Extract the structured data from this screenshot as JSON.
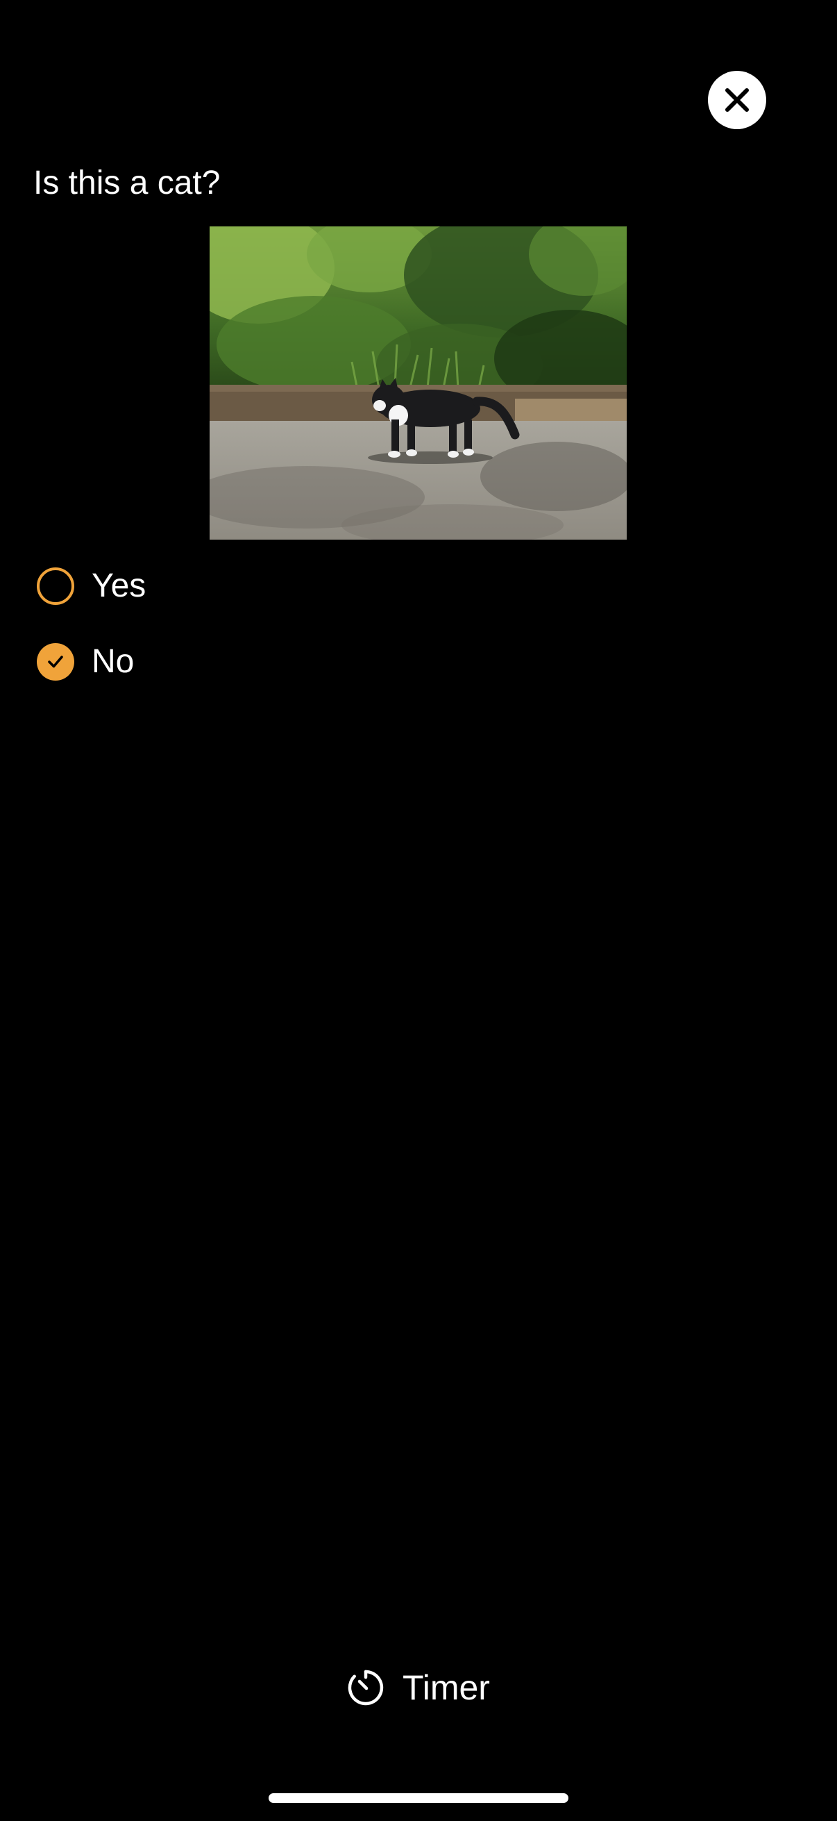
{
  "close_button": {
    "icon": "close-icon",
    "background": "#FFFFFF"
  },
  "question": {
    "text": "Is this a cat?"
  },
  "photo": {
    "subject": "black-and-white cat walking on a paved path in front of green bushes"
  },
  "options": [
    {
      "label": "Yes",
      "selected": false
    },
    {
      "label": "No",
      "selected": true
    }
  ],
  "accent_color": "#F0A33A",
  "footer": {
    "timer_label": "Timer",
    "timer_icon": "timer-icon"
  }
}
